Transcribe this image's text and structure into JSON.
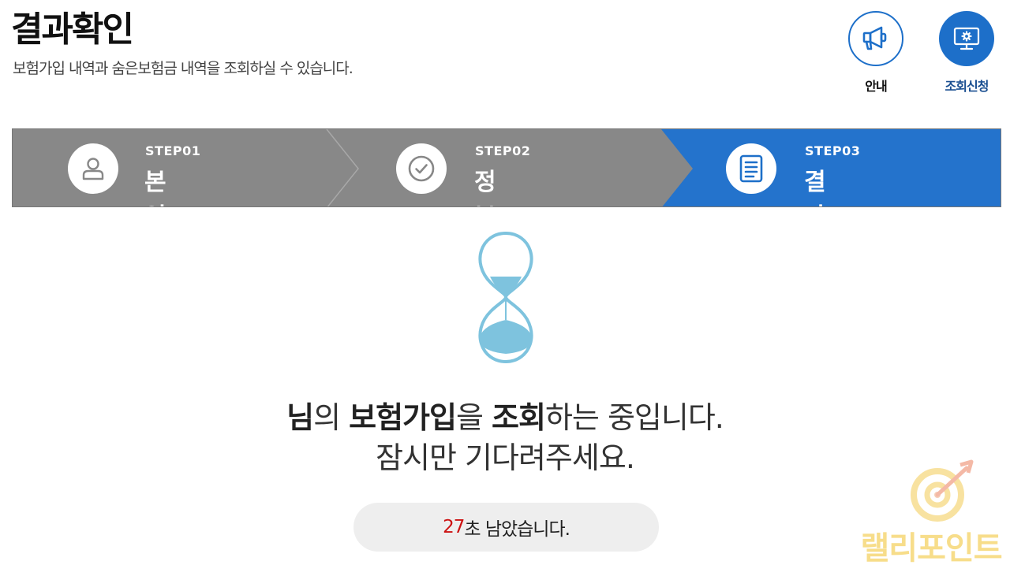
{
  "header": {
    "title": "결과확인",
    "subtitle": "보험가입 내역과 숨은보험금 내역을 조회하실 수 있습니다."
  },
  "actions": {
    "guide_label": "안내",
    "apply_label": "조회신청"
  },
  "steps": [
    {
      "num": "STEP01",
      "name": "본인인증",
      "icon": "user-icon",
      "active": false
    },
    {
      "num": "STEP02",
      "name": "정보동의",
      "icon": "check-circle-icon",
      "active": false
    },
    {
      "num": "STEP03",
      "name": "결과확인",
      "icon": "document-icon",
      "active": true
    }
  ],
  "colors": {
    "step_inactive": "#888888",
    "step_active": "#2473cc",
    "accent": "#1d6fc9",
    "countdown": "#cc1111",
    "hourglass": "#7ec3de"
  },
  "message": {
    "line1_p1": "님",
    "line1_p2": "의 ",
    "line1_p3": "보험가입",
    "line1_p4": "을 ",
    "line1_p5": "조회",
    "line1_p6": "하는 중입니다.",
    "line2": "잠시만 기다려주세요."
  },
  "timer": {
    "seconds": "27",
    "suffix": "초 남았습니다."
  },
  "watermark": {
    "text": "랠리포인트"
  }
}
